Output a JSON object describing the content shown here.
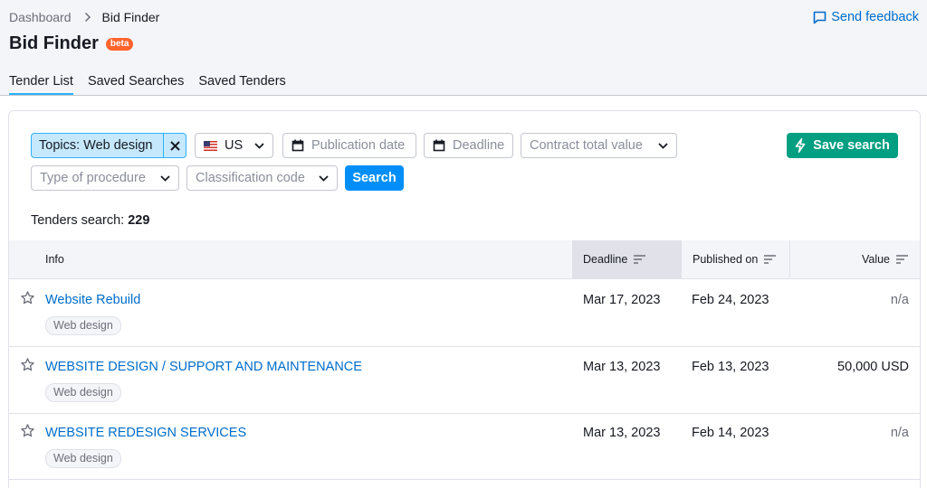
{
  "breadcrumb": {
    "root": "Dashboard",
    "current": "Bid Finder"
  },
  "feedback_label": "Send feedback",
  "page": {
    "title": "Bid Finder",
    "badge": "beta"
  },
  "tabs": [
    {
      "label": "Tender List",
      "active": true
    },
    {
      "label": "Saved Searches",
      "active": false
    },
    {
      "label": "Saved Tenders",
      "active": false
    }
  ],
  "filters": {
    "topic": "Topics: Web design",
    "country": "US",
    "publication_date": "Publication date",
    "deadline": "Deadline",
    "contract_value": "Contract total value",
    "procedure": "Type of procedure",
    "classification": "Classification code",
    "search_button": "Search",
    "save_button": "Save search"
  },
  "results": {
    "label": "Tenders search:",
    "count": "229"
  },
  "table": {
    "columns": {
      "info": "Info",
      "deadline": "Deadline",
      "published": "Published on",
      "value": "Value"
    },
    "rows": [
      {
        "title": "Website Rebuild",
        "tag": "Web design",
        "deadline": "Mar 17, 2023",
        "published": "Feb 24, 2023",
        "value": "n/a"
      },
      {
        "title": "WEBSITE DESIGN / SUPPORT AND MAINTENANCE",
        "tag": "Web design",
        "deadline": "Mar 13, 2023",
        "published": "Feb 13, 2023",
        "value": "50,000 USD"
      },
      {
        "title": "WEBSITE REDESIGN SERVICES",
        "tag": "Web design",
        "deadline": "Mar 13, 2023",
        "published": "Feb 14, 2023",
        "value": "n/a"
      }
    ]
  },
  "colors": {
    "accent_blue": "#008ff8",
    "link": "#006dca",
    "save_green": "#009f81",
    "beta_orange": "#ff642d"
  }
}
